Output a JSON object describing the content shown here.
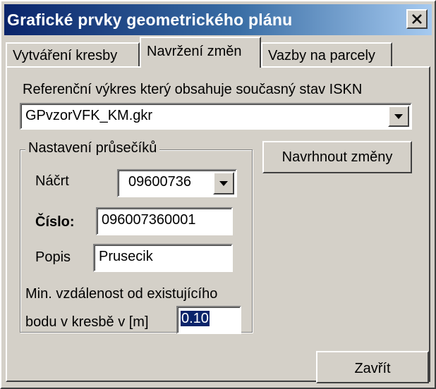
{
  "window": {
    "title": "Grafické prvky geometrického plánu"
  },
  "tabs": [
    {
      "label": "Vytváření kresby",
      "active": false
    },
    {
      "label": "Navržení změn",
      "active": true
    },
    {
      "label": "Vazby na parcely",
      "active": false
    }
  ],
  "reference": {
    "label": "Referenční výkres který obsahuje současný stav ISKN",
    "selected_value": "GPvzorVFK_KM.gkr"
  },
  "intersections": {
    "group_title": "Nastavení průsečíků",
    "sketch_label": "Náčrt",
    "sketch_value": "09600736",
    "number_label": "Číslo:",
    "number_value": "096007360001",
    "description_label": "Popis",
    "description_value": "Prusecik",
    "min_distance_label_line1": "Min. vzdálenost od existujícího",
    "min_distance_label_line2": "bodu v kresbě v [m]",
    "min_distance_value": "0.10"
  },
  "buttons": {
    "propose_changes": "Navrhnout změny",
    "close": "Zavřít"
  },
  "icons": {
    "close": "close-icon",
    "dropdown": "chevron-down-icon"
  },
  "colors": {
    "title_bar_start": "#0a246a",
    "title_bar_end": "#a6caf0",
    "selection": "#0a246a",
    "face": "#d4d0c8"
  }
}
